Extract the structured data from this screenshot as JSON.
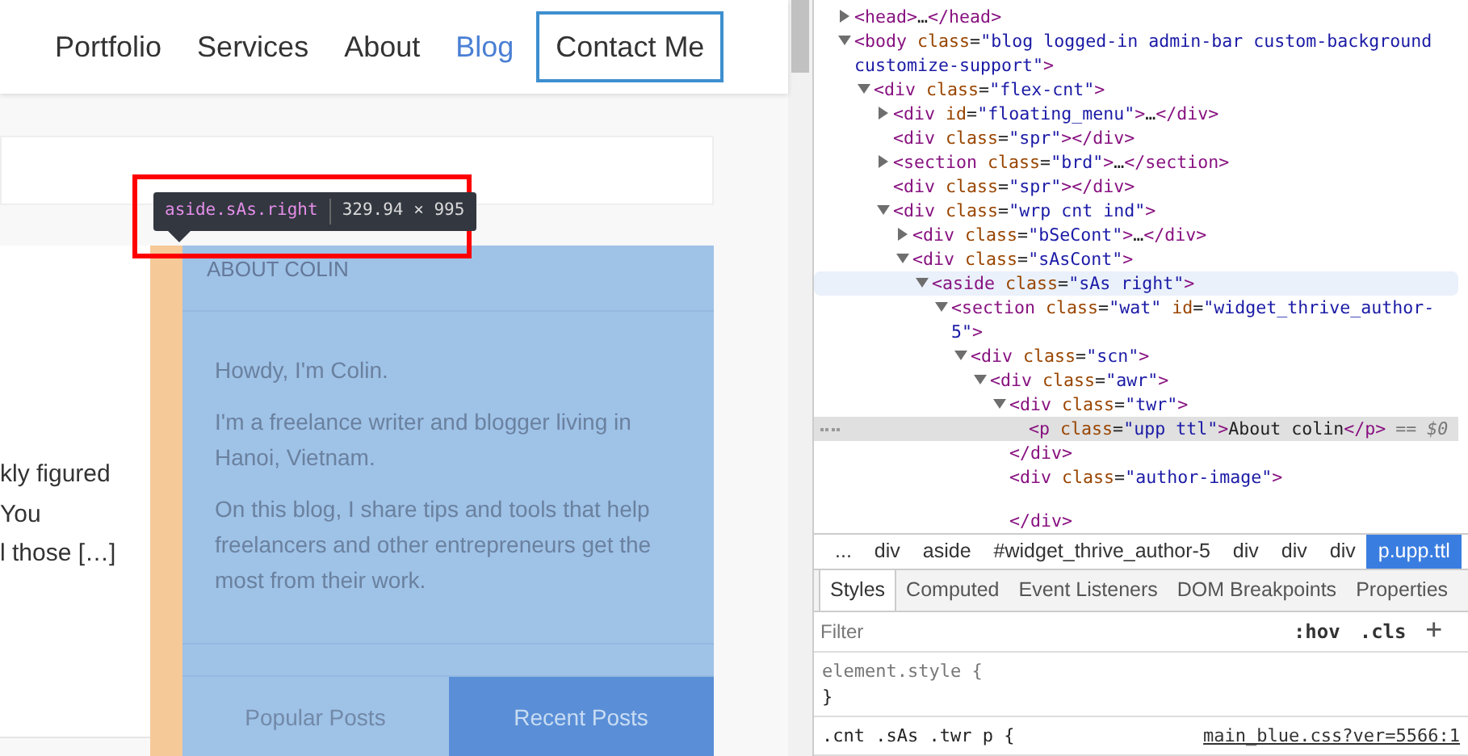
{
  "page": {
    "nav": [
      {
        "label": "Portfolio",
        "selected": false
      },
      {
        "label": "Services",
        "selected": false
      },
      {
        "label": "About",
        "selected": false
      },
      {
        "label": "Blog",
        "selected": true
      }
    ],
    "contact_button": "Contact Me",
    "article_lines": [
      "kly figured",
      "You",
      "l those […]"
    ],
    "sidebar": {
      "title": "ABOUT COLIN",
      "paragraphs": [
        "Howdy, I'm Colin.",
        "I'm a freelance writer and blogger living in Hanoi, Vietnam.",
        "On this blog, I share tips and tools that help freelancers and other entrepreneurs get the most from their work."
      ],
      "tabs": [
        {
          "label": "Popular Posts",
          "selected": false
        },
        {
          "label": "Recent Posts",
          "selected": true
        }
      ]
    },
    "tooltip": {
      "selector": "aside.sAs.right",
      "size": "329.94 × 995"
    }
  },
  "devtools": {
    "tree": [
      {
        "text": "<head>…</head>",
        "kind": "parent",
        "expanded": false,
        "selected": false,
        "hovered": false
      },
      {
        "text": "<body class=\"blog logged-in admin-bar custom-background customize-support\">",
        "kind": "parent",
        "expanded": true,
        "selected": false,
        "hovered": false,
        "children": [
          {
            "text": "<div class=\"flex-cnt\">",
            "kind": "parent",
            "expanded": true,
            "selected": false,
            "hovered": false,
            "children": [
              {
                "text": "<div id=\"floating_menu\">…</div>",
                "kind": "parent",
                "expanded": false,
                "selected": false,
                "hovered": false
              },
              {
                "text": "<div class=\"spr\"></div>",
                "kind": "leaf",
                "selected": false,
                "hovered": false
              },
              {
                "text": "<section class=\"brd\">…</section>",
                "kind": "parent",
                "expanded": false,
                "selected": false,
                "hovered": false
              },
              {
                "text": "<div class=\"spr\"></div>",
                "kind": "leaf",
                "selected": false,
                "hovered": false
              },
              {
                "text": "<div class=\"wrp cnt ind\">",
                "kind": "parent",
                "expanded": true,
                "selected": false,
                "hovered": false,
                "children": [
                  {
                    "text": "<div class=\"bSeCont\">…</div>",
                    "kind": "parent",
                    "expanded": false,
                    "selected": false,
                    "hovered": false
                  },
                  {
                    "text": "<div class=\"sAsCont\">",
                    "kind": "parent",
                    "expanded": true,
                    "selected": false,
                    "hovered": false,
                    "children": [
                      {
                        "text": "<aside class=\"sAs right\">",
                        "kind": "parent",
                        "expanded": true,
                        "selected": false,
                        "hovered": true,
                        "children": [
                          {
                            "text": "<section class=\"wat\" id=\"widget_thrive_author-5\">",
                            "kind": "parent",
                            "expanded": true,
                            "selected": false,
                            "hovered": false,
                            "children": [
                              {
                                "text": "<div class=\"scn\">",
                                "kind": "parent",
                                "expanded": true,
                                "selected": false,
                                "hovered": false,
                                "children": [
                                  {
                                    "text": "<div class=\"awr\">",
                                    "kind": "parent",
                                    "expanded": true,
                                    "selected": false,
                                    "hovered": false,
                                    "children": [
                                      {
                                        "text": "<div class=\"twr\">",
                                        "kind": "parent",
                                        "expanded": true,
                                        "selected": false,
                                        "hovered": false,
                                        "close": "</div>",
                                        "children": [
                                          {
                                            "text": "<p class=\"upp ttl\">About colin</p>",
                                            "kind": "leaf",
                                            "selected": true,
                                            "hovered": false,
                                            "marker": "== $0"
                                          }
                                        ]
                                      },
                                      {
                                        "text": "<div class=\"author-image\">",
                                        "kind": "leaf",
                                        "selected": false,
                                        "hovered": false,
                                        "close": "</div>"
                                      }
                                    ]
                                  }
                                ]
                              }
                            ]
                          }
                        ]
                      }
                    ]
                  }
                ]
              }
            ]
          }
        ]
      }
    ],
    "breadcrumbs": [
      {
        "label": "...",
        "selected": false
      },
      {
        "label": "div",
        "selected": false
      },
      {
        "label": "aside",
        "selected": false
      },
      {
        "label": "#widget_thrive_author-5",
        "selected": false
      },
      {
        "label": "div",
        "selected": false
      },
      {
        "label": "div",
        "selected": false
      },
      {
        "label": "div",
        "selected": false
      },
      {
        "label": "p.upp.ttl",
        "selected": true
      }
    ],
    "panel_tabs": [
      {
        "label": "Styles",
        "selected": true
      },
      {
        "label": "Computed",
        "selected": false
      },
      {
        "label": "Event Listeners",
        "selected": false
      },
      {
        "label": "DOM Breakpoints",
        "selected": false
      },
      {
        "label": "Properties",
        "selected": false
      }
    ],
    "filter": {
      "placeholder": "Filter"
    },
    "filter_buttons": [
      ":hov",
      ".cls",
      "+"
    ],
    "rules": [
      {
        "selector": "element.style {",
        "close": "}"
      },
      {
        "selector": ".cnt .sAs .twr p {",
        "source": "main_blue.css?ver=5566:1"
      }
    ]
  }
}
